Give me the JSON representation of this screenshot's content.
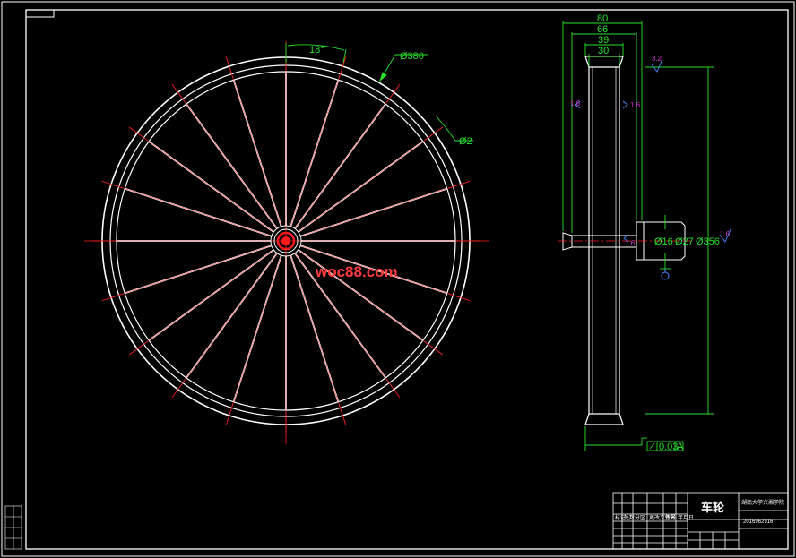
{
  "drawing": {
    "front_view": {
      "spoke_angle_label": "18°",
      "rim_diameter_label": "Ø380",
      "spoke_diameter_label": "Ø2"
    },
    "side_view": {
      "width_labels": [
        "80",
        "66",
        "39",
        "30"
      ],
      "hub_labels": [
        "Ø16",
        "Ø27",
        "Ø356"
      ],
      "roughness_labels": [
        "3.2",
        "1.6",
        "1.6",
        "1.6",
        "1.6"
      ],
      "tolerance_label": "0.03",
      "datum_label": "A"
    },
    "watermark": "woc88.com",
    "title_block": {
      "part_name": "车轮",
      "school": "湖南大学兴湘学院",
      "drawing_number": "2016962916",
      "small_rows": [
        "标记",
        "处数",
        "分区",
        "更改文件号",
        "签名",
        "年月日"
      ]
    }
  },
  "colors": {
    "background": "#000000",
    "line": "#ffffff",
    "dimension": "#27e127",
    "center": "#ff2020",
    "roughness": "#d437d4",
    "hub": "#ff1a1a"
  }
}
